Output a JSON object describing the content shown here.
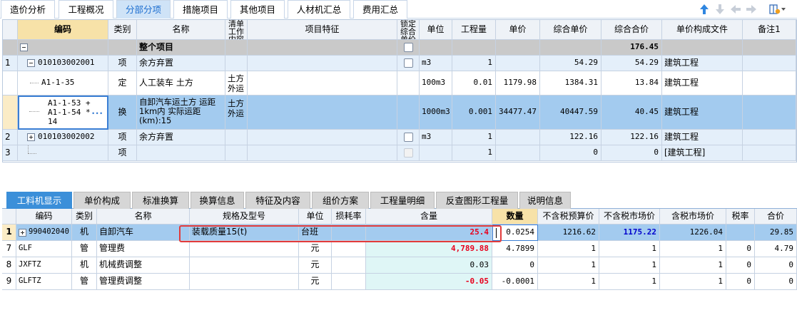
{
  "top_tabs": [
    "造价分析",
    "工程概况",
    "分部分项",
    "措施项目",
    "其他项目",
    "人材机汇总",
    "费用汇总"
  ],
  "active_top_tab": 2,
  "toolbar_icons": [
    "arrow-up-icon",
    "arrow-down-icon",
    "arrow-left-icon",
    "arrow-right-icon",
    "column-settings-icon"
  ],
  "grid1": {
    "headers": [
      "编码",
      "类别",
      "名称",
      "清单工作内容",
      "项目特征",
      "锁定综合单价",
      "单位",
      "工程量",
      "单价",
      "综合单价",
      "综合合价",
      "单价构成文件",
      "备注1"
    ],
    "header_name3_lines": [
      "清单",
      "工作",
      "内容"
    ],
    "header_lock_lines": [
      "锁定",
      "综合",
      "单价"
    ],
    "rows": [
      {
        "num": "",
        "code": "",
        "type": "",
        "name": "整个项目",
        "work": "",
        "feature": "",
        "lock": true,
        "unit": "",
        "qty": "",
        "price": "",
        "uprice": "",
        "total": "176.45",
        "file": "",
        "note": ""
      },
      {
        "num": "1",
        "code": "010103002001",
        "type": "项",
        "name": "余方弃置",
        "work": "",
        "feature": "",
        "lock": true,
        "unit": "m3",
        "qty": "1",
        "price": "",
        "uprice": "54.29",
        "total": "54.29",
        "file": "建筑工程",
        "note": ""
      },
      {
        "num": "",
        "code": "A1-1-35",
        "type": "定",
        "name": "人工装车 土方",
        "work": "土方外运",
        "feature": "",
        "lock": false,
        "unit": "100m3",
        "qty": "0.01",
        "price": "1179.98",
        "uprice": "1384.31",
        "total": "13.84",
        "file": "建筑工程",
        "note": ""
      },
      {
        "num": "",
        "code": "A1-1-53 + A1-1-54 * 14",
        "code_lines": [
          "A1-1-53 +",
          "A1-1-54 *",
          "14"
        ],
        "type": "换",
        "name": "自卸汽车运土方 运距1km内 实际运距(km):15",
        "name_lines": [
          "自卸汽车运土方 运距",
          "1km内  实际运距",
          "(km):15"
        ],
        "work": "土方外运",
        "feature": "",
        "lock": false,
        "unit": "1000m3",
        "qty": "0.001",
        "price": "34477.47",
        "uprice": "40447.59",
        "total": "40.45",
        "file": "建筑工程",
        "note": ""
      },
      {
        "num": "2",
        "code": "010103002002",
        "type": "项",
        "name": "余方弃置",
        "work": "",
        "feature": "",
        "lock": true,
        "unit": "m3",
        "qty": "1",
        "price": "",
        "uprice": "122.16",
        "total": "122.16",
        "file": "建筑工程",
        "note": ""
      },
      {
        "num": "3",
        "code": "",
        "type": "项",
        "name": "",
        "work": "",
        "feature": "",
        "lock": true,
        "unit": "",
        "qty": "1",
        "price": "",
        "uprice": "0",
        "total": "0",
        "file": "[建筑工程]",
        "note": ""
      }
    ]
  },
  "bottom_tabs": [
    "工料机显示",
    "单价构成",
    "标准换算",
    "换算信息",
    "特征及内容",
    "组价方案",
    "工程量明细",
    "反查图形工程量",
    "说明信息"
  ],
  "active_bottom_tab": 0,
  "grid2": {
    "headers": [
      "编码",
      "类别",
      "名称",
      "规格及型号",
      "单位",
      "损耗率",
      "含量",
      "数量",
      "不含税预算价",
      "不含税市场价",
      "含税市场价",
      "税率",
      "合价"
    ],
    "rows": [
      {
        "num": "1",
        "code": "990402040",
        "type": "机",
        "name": "自卸汽车",
        "spec": "装载质量15(t)",
        "unit": "台班",
        "loss": "",
        "content": "25.4",
        "amount": "0.0254",
        "budget": "1216.62",
        "market": "1175.22",
        "market_tax": "1226.04",
        "rate": "",
        "total": "29.85"
      },
      {
        "num": "7",
        "code": "GLF",
        "type": "管",
        "name": "管理费",
        "spec": "",
        "unit": "元",
        "loss": "",
        "content": "4,789.88",
        "amount": "4.7899",
        "budget": "1",
        "market": "1",
        "market_tax": "1",
        "rate": "0",
        "total": "4.79"
      },
      {
        "num": "8",
        "code": "JXFTZ",
        "type": "机",
        "name": "机械费调整",
        "spec": "",
        "unit": "元",
        "loss": "",
        "content": "0.03",
        "amount": "0",
        "budget": "1",
        "market": "1",
        "market_tax": "1",
        "rate": "0",
        "total": "0"
      },
      {
        "num": "9",
        "code": "GLFTZ",
        "type": "管",
        "name": "管理费调整",
        "spec": "",
        "unit": "元",
        "loss": "",
        "content": "-0.05",
        "amount": "-0.0001",
        "budget": "1",
        "market": "1",
        "market_tax": "1",
        "rate": "0",
        "total": "0"
      }
    ]
  },
  "colors": {
    "accent": "#1e6fd0",
    "selected_row": "#a3cbef",
    "content_red": "#e8001c",
    "market_blue": "#0000cc",
    "active_tab": "#3b8fd9",
    "highlight_box": "#e23b3b"
  }
}
